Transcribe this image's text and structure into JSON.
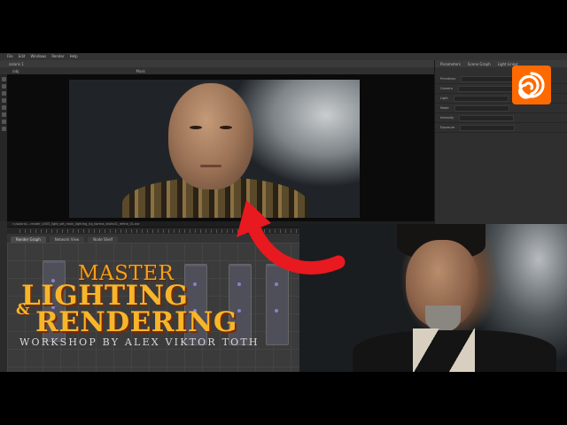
{
  "app": {
    "menu": [
      "File",
      "Edit",
      "Windows",
      "Render",
      "Help"
    ],
    "desktop_tab": "solaris 1",
    "toolbar_left": "/obj",
    "toolbar_center": "Mask",
    "status_text": "c:/solaris/...render_v003_light_set_main_lighting_rig_karma_shots01_refine_01.exr"
  },
  "network_tabs": [
    "Render Graph",
    "Network View",
    "Node Shelf"
  ],
  "right_panel": {
    "tabs": [
      "Parameters",
      "Scene Graph",
      "Light Linker"
    ],
    "rows": [
      "Primitives",
      "Camera",
      "Light",
      "Mode",
      "Intensity",
      "Exposure"
    ]
  },
  "title": {
    "line1": "MASTER",
    "line2": "LIGHTING",
    "amp": "&",
    "line3": "RENDERING",
    "subtitle": "WORKSHOP BY ALEX VIKTOR TOTH"
  },
  "colors": {
    "title": "#f7b62a",
    "arrow": "#e8191f",
    "logo": "#ff6a00"
  },
  "icons": {
    "logo": "houdini-logo-icon",
    "arrow": "red-arrow-icon"
  }
}
